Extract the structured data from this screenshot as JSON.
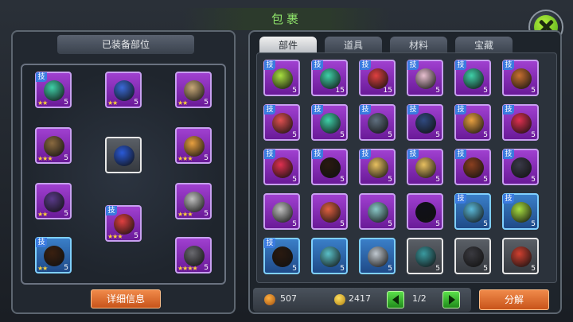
{
  "title": "包裹",
  "left_panel": {
    "header": "已装备部位",
    "detail_button": "详细信息",
    "slots": [
      {
        "name": "slot-1",
        "badge": "技",
        "count": "5",
        "stars": "★★",
        "color": "#3fd0a8",
        "rarity": "purple"
      },
      {
        "name": "slot-2",
        "badge": "",
        "count": "5",
        "stars": "★★",
        "color": "#3a6ad8",
        "rarity": "purple"
      },
      {
        "name": "slot-3",
        "badge": "",
        "count": "5",
        "stars": "★★",
        "color": "#c8a878",
        "rarity": "purple"
      },
      {
        "name": "slot-4",
        "badge": "",
        "count": "5",
        "stars": "★★★",
        "color": "#8a6a40",
        "rarity": "purple"
      },
      {
        "name": "slot-center",
        "badge": "",
        "count": "",
        "stars": "",
        "color": "#2a5ad8",
        "rarity": "white"
      },
      {
        "name": "slot-5",
        "badge": "",
        "count": "5",
        "stars": "★★★",
        "color": "#e8a040",
        "rarity": "purple"
      },
      {
        "name": "slot-6",
        "badge": "",
        "count": "5",
        "stars": "★★",
        "color": "#5a3a8a",
        "rarity": "purple"
      },
      {
        "name": "slot-7",
        "badge": "技",
        "count": "5",
        "stars": "★★★",
        "color": "#e04040",
        "rarity": "purple"
      },
      {
        "name": "slot-8",
        "badge": "",
        "count": "5",
        "stars": "★★★",
        "color": "#c0c0c0",
        "rarity": "purple"
      },
      {
        "name": "slot-9",
        "badge": "技",
        "count": "5",
        "stars": "★★",
        "color": "#3a2010",
        "rarity": "blue"
      },
      {
        "name": "slot-10",
        "badge": "",
        "count": "5",
        "stars": "★★★★",
        "color": "#6a6a70",
        "rarity": "purple"
      }
    ]
  },
  "tabs": [
    {
      "label": "部件",
      "active": true
    },
    {
      "label": "道具",
      "active": false
    },
    {
      "label": "材料",
      "active": false
    },
    {
      "label": "宝藏",
      "active": false
    }
  ],
  "items": [
    {
      "badge": "技",
      "count": "5",
      "color": "#a8e040",
      "rarity": "purple"
    },
    {
      "badge": "技",
      "count": "15",
      "color": "#3fd0a8",
      "rarity": "purple"
    },
    {
      "badge": "技",
      "count": "15",
      "color": "#e04040",
      "rarity": "purple"
    },
    {
      "badge": "技",
      "count": "5",
      "color": "#e8c0d0",
      "rarity": "purple"
    },
    {
      "badge": "技",
      "count": "5",
      "color": "#3fd0a8",
      "rarity": "purple"
    },
    {
      "badge": "技",
      "count": "5",
      "color": "#c87030",
      "rarity": "purple"
    },
    {
      "badge": "技",
      "count": "5",
      "color": "#e05050",
      "rarity": "purple"
    },
    {
      "badge": "技",
      "count": "5",
      "color": "#3fd0a8",
      "rarity": "purple"
    },
    {
      "badge": "技",
      "count": "5",
      "color": "#607080",
      "rarity": "purple"
    },
    {
      "badge": "技",
      "count": "5",
      "color": "#304a80",
      "rarity": "purple"
    },
    {
      "badge": "技",
      "count": "5",
      "color": "#e8a040",
      "rarity": "purple"
    },
    {
      "badge": "技",
      "count": "5",
      "color": "#e03050",
      "rarity": "purple"
    },
    {
      "badge": "技",
      "count": "5",
      "color": "#e03050",
      "rarity": "purple"
    },
    {
      "badge": "技",
      "count": "5",
      "color": "#2a1a10",
      "rarity": "purple"
    },
    {
      "badge": "技",
      "count": "5",
      "color": "#e8c060",
      "rarity": "purple"
    },
    {
      "badge": "技",
      "count": "5",
      "color": "#e8c060",
      "rarity": "purple"
    },
    {
      "badge": "技",
      "count": "5",
      "color": "#8a4020",
      "rarity": "purple"
    },
    {
      "badge": "技",
      "count": "5",
      "color": "#3a3a48",
      "rarity": "purple"
    },
    {
      "badge": "",
      "count": "5",
      "color": "#c0c0c0",
      "rarity": "purple"
    },
    {
      "badge": "",
      "count": "5",
      "color": "#e06040",
      "rarity": "purple"
    },
    {
      "badge": "",
      "count": "5",
      "color": "#8ac8c8",
      "rarity": "purple"
    },
    {
      "badge": "",
      "count": "5",
      "color": "#101018",
      "rarity": "purple"
    },
    {
      "badge": "技",
      "count": "5",
      "color": "#5ab8d8",
      "rarity": "blue"
    },
    {
      "badge": "技",
      "count": "5",
      "color": "#a8e040",
      "rarity": "blue"
    },
    {
      "badge": "技",
      "count": "5",
      "color": "#2a1a10",
      "rarity": "blue"
    },
    {
      "badge": "",
      "count": "5",
      "color": "#5ac0c8",
      "rarity": "blue"
    },
    {
      "badge": "",
      "count": "5",
      "color": "#c0c8d0",
      "rarity": "blue"
    },
    {
      "badge": "",
      "count": "5",
      "color": "#3a9aa0",
      "rarity": "white"
    },
    {
      "badge": "",
      "count": "5",
      "color": "#3a3a40",
      "rarity": "white"
    },
    {
      "badge": "",
      "count": "5",
      "color": "#d04030",
      "rarity": "white"
    }
  ],
  "bottom": {
    "resource1": "507",
    "resource2": "2417",
    "page": "1/2",
    "decompose_button": "分解"
  },
  "colors": {
    "accent": "#8ee26a",
    "button_orange": "#e07030",
    "rarity_purple": "#a040d0",
    "rarity_blue": "#3a7fc8"
  }
}
